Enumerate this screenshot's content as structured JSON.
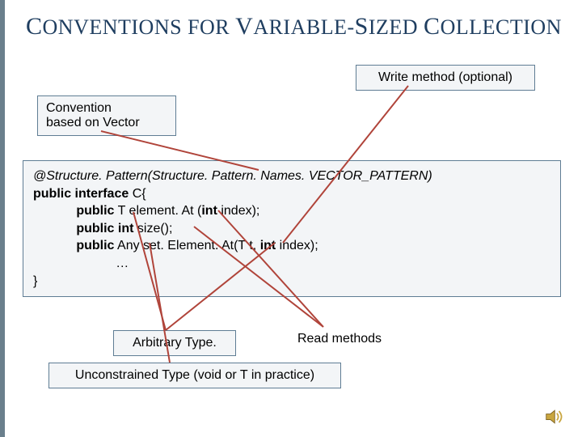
{
  "title": {
    "c1": "C",
    "w1": "ONVENTIONS",
    "w2": " FOR ",
    "c3": "V",
    "w3": "ARIABLE",
    "dash": "-",
    "c4": "S",
    "w4": "IZED ",
    "c5": "C",
    "w5": "OLLECTION"
  },
  "labels": {
    "write": "Write method (optional)",
    "convention_l1": "Convention",
    "convention_l2": "based on Vector",
    "arbitrary": "Arbitrary Type.",
    "read": "Read methods",
    "unconstrained": "Unconstrained Type (void or T in practice)"
  },
  "code": {
    "annotation_prefix": "@Structure. Pattern(Structure. Pattern. Names. ",
    "annotation_const": "VECTOR_PATTERN",
    "annotation_suffix": ")",
    "decl": "public interface",
    "decl_name": " C{",
    "m1_kw": "public",
    "m1_rest": " T element. At (",
    "m1_int": "int",
    "m1_tail": " index);",
    "m2_kw": "public int",
    "m2_rest": " size();",
    "m3_kw": "public",
    "m3_rest": " Any set. Element. At(T t, ",
    "m3_int": "int",
    "m3_tail": " index);",
    "ellipsis": "…",
    "close": "}"
  }
}
